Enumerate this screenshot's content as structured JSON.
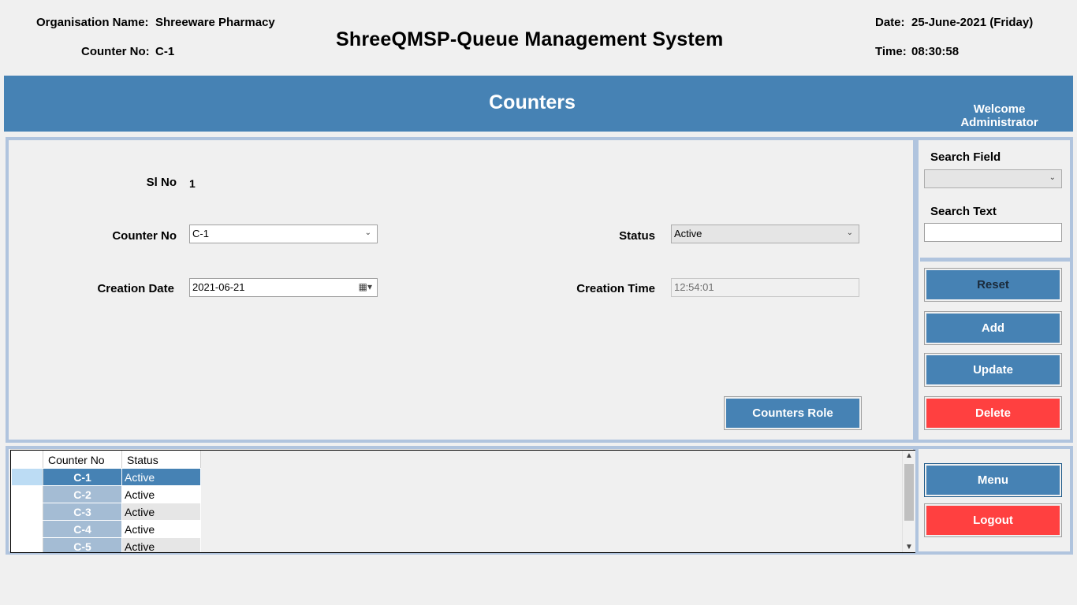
{
  "header": {
    "org_label": "Organisation Name:",
    "org_value": "Shreeware Pharmacy",
    "counter_label": "Counter No:",
    "counter_value": "C-1",
    "app_title": "ShreeQMSP-Queue Management System",
    "date_label": "Date:",
    "date_value": "25-June-2021 (Friday)",
    "time_label": "Time:",
    "time_value": "08:30:58"
  },
  "banner": {
    "title": "Counters",
    "welcome_line1": "Welcome",
    "welcome_line2": "Administrator"
  },
  "form": {
    "sl_no_label": "Sl No",
    "sl_no_value": "1",
    "counter_no_label": "Counter No",
    "counter_no_value": "C-1",
    "status_label": "Status",
    "status_value": "Active",
    "creation_date_label": "Creation Date",
    "creation_date_value": "2021-06-21",
    "creation_time_label": "Creation Time",
    "creation_time_value": "12:54:01",
    "counters_role_button": "Counters Role"
  },
  "search": {
    "field_label": "Search Field",
    "field_value": "",
    "text_label": "Search Text",
    "text_value": ""
  },
  "actions": {
    "reset": "Reset",
    "add": "Add",
    "update": "Update",
    "delete": "Delete"
  },
  "nav": {
    "menu": "Menu",
    "logout": "Logout"
  },
  "grid": {
    "columns": [
      "Counter No",
      "Status"
    ],
    "rows": [
      {
        "counter_no": "C-1",
        "status": "Active"
      },
      {
        "counter_no": "C-2",
        "status": "Active"
      },
      {
        "counter_no": "C-3",
        "status": "Active"
      },
      {
        "counter_no": "C-4",
        "status": "Active"
      },
      {
        "counter_no": "C-5",
        "status": "Active"
      }
    ]
  },
  "colors": {
    "accent": "#4682b4",
    "panel_border": "#b0c4de",
    "danger": "#ff4040"
  },
  "icons": [
    "chevron-down-icon",
    "calendar-icon",
    "scroll-up-icon",
    "scroll-down-icon"
  ]
}
